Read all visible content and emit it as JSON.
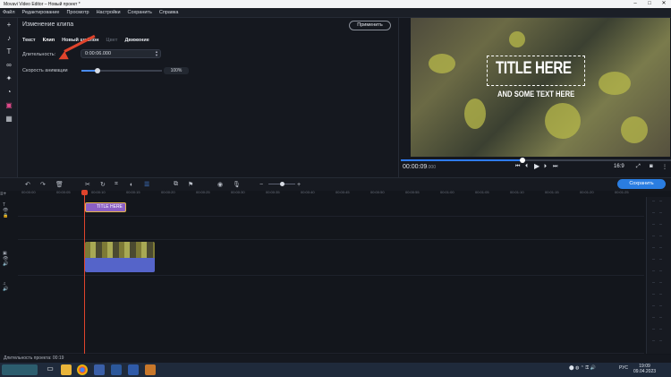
{
  "window": {
    "title": "Movavi Video Editor – Новый проект *",
    "minimize": "–",
    "maximize": "□",
    "close": "✕"
  },
  "menu": [
    "Файл",
    "Редактирование",
    "Просмотр",
    "Настройки",
    "Сохранить",
    "Справка"
  ],
  "props": {
    "title": "Изменение клипа",
    "apply": "Применить",
    "tabs": [
      "Текст",
      "Клип",
      "Новый шаблон",
      "Цвет",
      "Движение"
    ],
    "duration_label": "Длительность:",
    "duration_value": "0:00:06.000",
    "anim_label": "Скорость анимации",
    "anim_value": "100%",
    "anim_level": 0.2
  },
  "preview": {
    "title_line1": "TITLE HERE",
    "title_line2": "AND SOME TEXT HERE",
    "time": "00:00:09",
    "time_fraction": "000",
    "aspect": "16:9",
    "progress": 0.45
  },
  "timeline": {
    "save": "Сохранить",
    "ruler": [
      "00:00:00",
      "00:00:05",
      "00:00:10",
      "00:00:15",
      "00:00:20",
      "00:00:25",
      "00:00:30",
      "00:00:35",
      "00:00:40",
      "00:00:45",
      "00:00:50",
      "00:00:55",
      "00:01:00",
      "00:01:05",
      "00:01:10",
      "00:01:15",
      "00:01:20",
      "00:01:25"
    ],
    "title_clip": "TITLE HERE"
  },
  "status": "Длительность проекта: 00:19",
  "taskbar": {
    "time": "19:09",
    "date": "09.04.2023",
    "lang": "РУС"
  },
  "colors": {
    "accent": "#2a7de1",
    "title_clip": "#8b5fc4",
    "audio": "#5564c9",
    "playhead": "#e0442c"
  }
}
